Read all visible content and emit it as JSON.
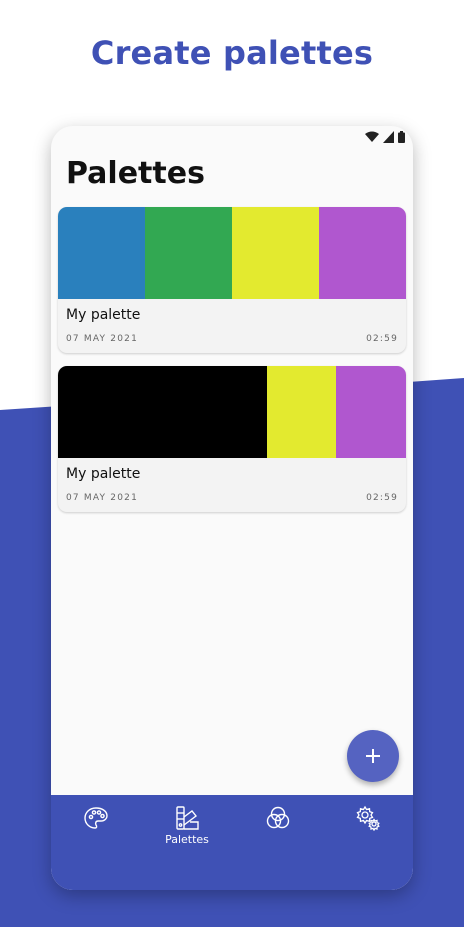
{
  "headline": "Create palettes",
  "screen": {
    "title": "Palettes",
    "status_icons": [
      "wifi-icon",
      "signal-icon",
      "battery-icon"
    ]
  },
  "palettes": [
    {
      "name": "My palette",
      "date": "07 MAY 2021",
      "time": "02:59",
      "colors": [
        "#2a80bd",
        "#32a852",
        "#e3ea2f",
        "#b057cf"
      ],
      "weights": [
        1,
        1,
        1,
        1
      ]
    },
    {
      "name": "My palette",
      "date": "07 MAY 2021",
      "time": "02:59",
      "colors": [
        "#000000",
        "#e3ea2f",
        "#b057cf"
      ],
      "weights": [
        3,
        1,
        1
      ]
    }
  ],
  "fab": {
    "icon": "plus-icon",
    "label": "+"
  },
  "navbar": {
    "items": [
      {
        "icon": "palette-icon",
        "label": ""
      },
      {
        "icon": "swatch-book-icon",
        "label": "Palettes"
      },
      {
        "icon": "color-mix-icon",
        "label": ""
      },
      {
        "icon": "settings-gears-icon",
        "label": ""
      }
    ]
  },
  "colors": {
    "accent": "#3f51b5",
    "fab": "#5563c1"
  }
}
